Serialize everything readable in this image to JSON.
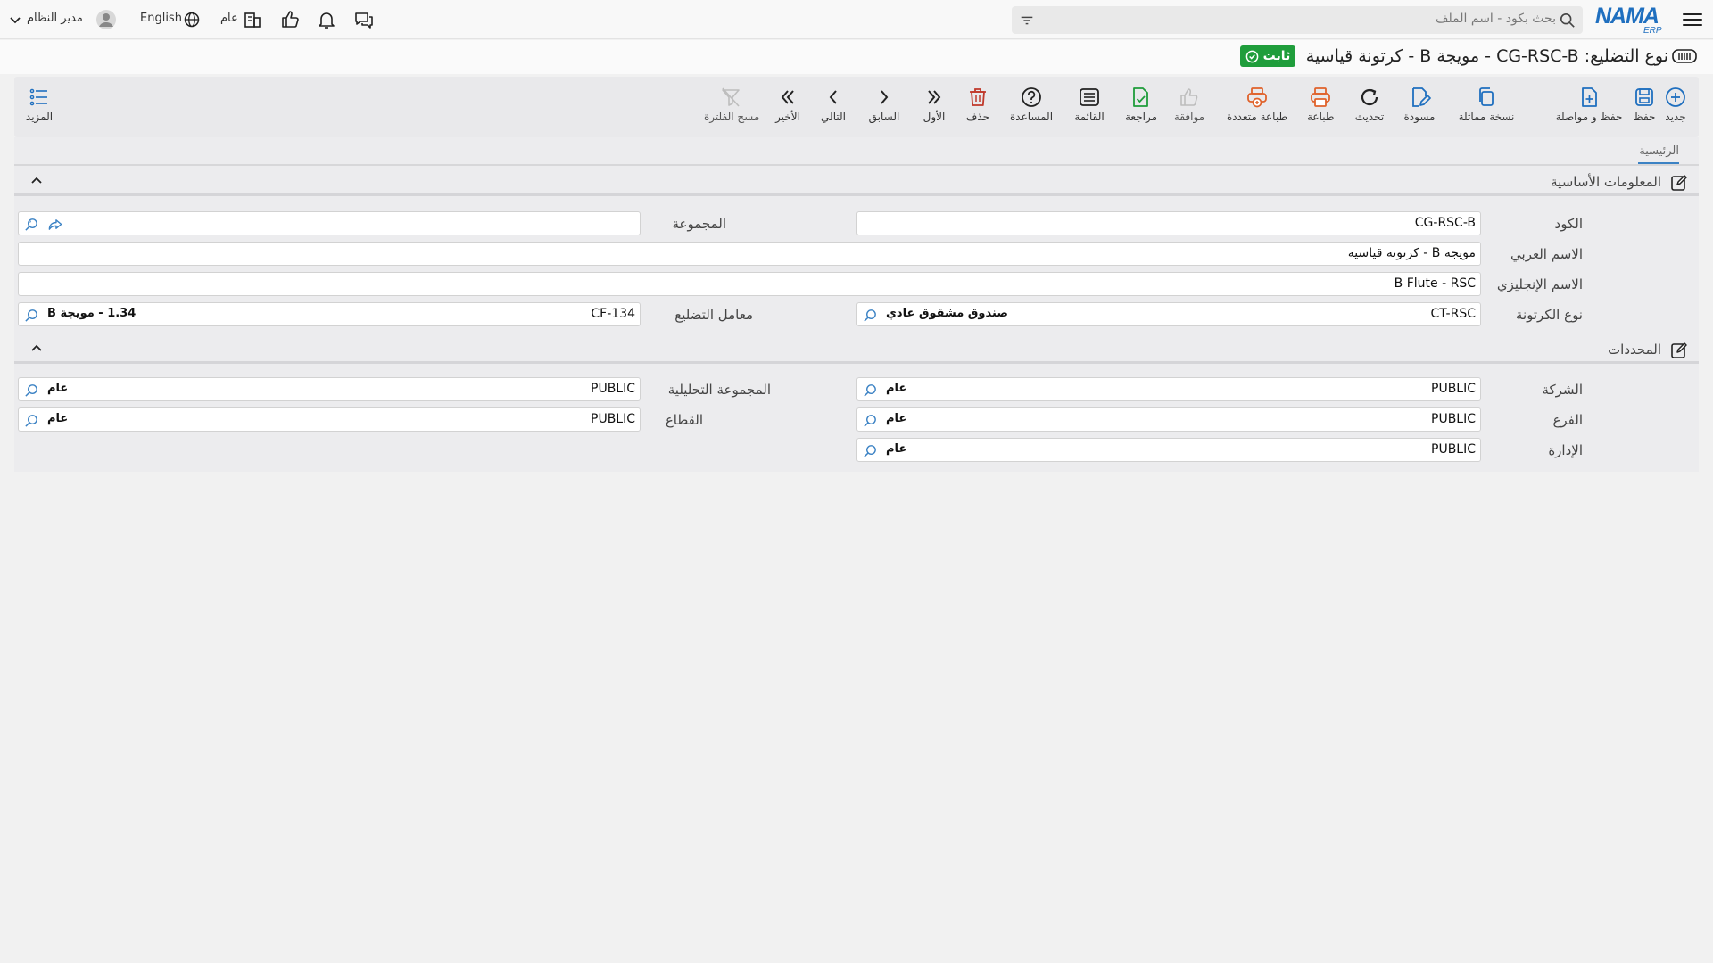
{
  "topbar": {
    "search_placeholder": "بحث بكود - اسم الملف",
    "user_name": "مدير النظام",
    "language": "English",
    "company": "عام"
  },
  "header": {
    "title": "نوع التضليع: CG-RSC-B - مويجة B - كرتونة قياسية",
    "status_badge": "ثابت"
  },
  "toolbar": {
    "new": "جديد",
    "save": "حفظ",
    "save_continue": "حفظ و مواصلة",
    "duplicate": "نسخة مماثلة",
    "draft": "مسودة",
    "refresh": "تحديث",
    "print": "طباعة",
    "multi_print": "طباعة متعددة",
    "approve": "موافقة",
    "review": "مراجعة",
    "list": "القائمة",
    "help": "المساعدة",
    "delete": "حذف",
    "first": "الأول",
    "previous": "السابق",
    "next": "التالي",
    "last": "الأخير",
    "clear_filter": "مسح الفلترة",
    "more": "المزيد"
  },
  "tabs": {
    "main": "الرئيسية"
  },
  "basic_info": {
    "title": "المعلومات الأساسية",
    "code_label": "الكود",
    "code_value": "CG-RSC-B",
    "group_label": "المجموعة",
    "group_value": "",
    "arabic_name_label": "الاسم العربي",
    "arabic_name_value": "مويجة B - كرتونة قياسية",
    "english_name_label": "الاسم الإنجليزي",
    "english_name_value": "B Flute - RSC",
    "carton_type_label": "نوع الكرتونة",
    "carton_type_code": "CT-RSC",
    "carton_type_desc": "صندوق مشقوق عادي",
    "flute_factor_label": "معامل التضليع",
    "flute_factor_code": "CF-134",
    "flute_factor_desc": "1.34 - مويجة B"
  },
  "dimensions": {
    "title": "المحددات",
    "company_label": "الشركة",
    "company_code": "PUBLIC",
    "company_desc": "عام",
    "analytic_group_label": "المجموعة التحليلية",
    "analytic_group_code": "PUBLIC",
    "analytic_group_desc": "عام",
    "branch_label": "الفرع",
    "branch_code": "PUBLIC",
    "branch_desc": "عام",
    "sector_label": "القطاع",
    "sector_code": "PUBLIC",
    "sector_desc": "عام",
    "department_label": "الإدارة",
    "department_code": "PUBLIC",
    "department_desc": "عام"
  },
  "colors": {
    "accent": "#1f6fbf",
    "badge": "#1f9d3b",
    "print_icon": "#e0622b",
    "delete_icon": "#c0392b",
    "approve_icon": "#1f9d3b"
  }
}
